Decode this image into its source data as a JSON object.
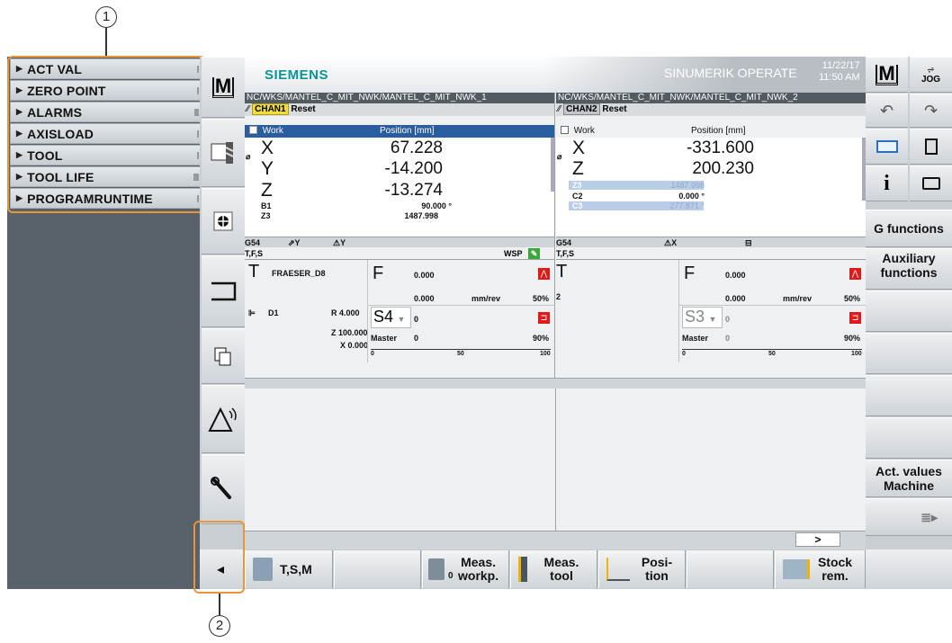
{
  "callouts": {
    "one": "1",
    "two": "2"
  },
  "left_menu": [
    {
      "label": "ACT VAL"
    },
    {
      "label": "ZERO POINT"
    },
    {
      "label": "ALARMS"
    },
    {
      "label": "AXISLOAD"
    },
    {
      "label": "TOOL"
    },
    {
      "label": "TOOL LIFE"
    },
    {
      "label": "PROGRAMRUNTIME"
    }
  ],
  "vertical_keys": {
    "m_label": "M",
    "back_label": "◂"
  },
  "header": {
    "brand": "SIEMENS",
    "product": "SINUMERIK OPERATE",
    "date": "11/22/17",
    "time": "11:50 AM"
  },
  "channel1": {
    "path": "NC/WKS/MANTEL_C_MIT_NWK/MANTEL_C_MIT_NWK_1",
    "chan": "CHAN1",
    "state": "Reset",
    "work_label": "Work",
    "pos_label": "Position [mm]",
    "axes": [
      {
        "name": "X",
        "value": "67.228"
      },
      {
        "name": "Y",
        "value": "-14.200"
      },
      {
        "name": "Z",
        "value": "-13.274"
      }
    ],
    "small_axes": [
      {
        "name": "B1",
        "value": "90.000 °"
      },
      {
        "name": "Z3",
        "value": "1487.998"
      }
    ],
    "frame": "G54",
    "frame_y1": "⇗Y",
    "frame_y2": "⚠Y",
    "tfs": "T,F,S",
    "wsp": "WSP",
    "tool_letter": "T",
    "tool_name": "FRAESER_D8",
    "f_letter": "F",
    "f_val1": "0.000",
    "f_val2": "0.000",
    "f_unit": "mm/rev",
    "f_pct": "50%",
    "d_label": "D1",
    "r_val": "R 4.000",
    "z_val": "Z 100.000",
    "x_val": "X 0.000",
    "spindle": "S4",
    "s_val": "0",
    "master": "Master",
    "master_val": "0",
    "master_pct": "90%",
    "scale_0": "0",
    "scale_50": "50",
    "scale_100": "100"
  },
  "channel2": {
    "path": "NC/WKS/MANTEL_C_MIT_NWK/MANTEL_C_MIT_NWK_2",
    "chan": "CHAN2",
    "state": "Reset",
    "work_label": "Work",
    "pos_label": "Position [mm]",
    "axes": [
      {
        "name": "X",
        "value": "-331.600"
      },
      {
        "name": "Z",
        "value": "200.230"
      }
    ],
    "small_axes": [
      {
        "name": "Z3",
        "value": "1487.998"
      },
      {
        "name": "C2",
        "value": "0.000 °"
      },
      {
        "name": "C3",
        "value": "277.871 °"
      }
    ],
    "frame": "G54",
    "frame_x": "⚠X",
    "frame_icon": "⊟",
    "tfs": "T,F,S",
    "tool_letter": "T",
    "tool_sub": "2",
    "f_letter": "F",
    "f_val1": "0.000",
    "f_val2": "0.000",
    "f_unit": "mm/rev",
    "f_pct": "50%",
    "spindle": "S3",
    "s_val": "0",
    "master": "Master",
    "master_val": "0",
    "master_pct": "90%",
    "scale_0": "0",
    "scale_50": "50",
    "scale_100": "100"
  },
  "scroll_arrow": ">",
  "right_keys": {
    "m_label": "M",
    "jog_label": "JOG",
    "g_functions": "G functions",
    "aux_functions": "Auxiliary functions",
    "act_values": "Act. values Machine",
    "info": "i"
  },
  "bottom_keys": [
    {
      "label": "T,S,M"
    },
    {
      "label": "Meas. workp."
    },
    {
      "label": "Meas. tool"
    },
    {
      "label": "Posi- tion"
    },
    {
      "label": "Stock rem."
    }
  ],
  "bottom_meas_sub": "0",
  "colors": {
    "accent": "#0d9494",
    "callout": "#e8963a",
    "chan_badge": "#f0dc3c",
    "alert_red": "#e01a1a",
    "pos_header": "#2a5da0"
  }
}
